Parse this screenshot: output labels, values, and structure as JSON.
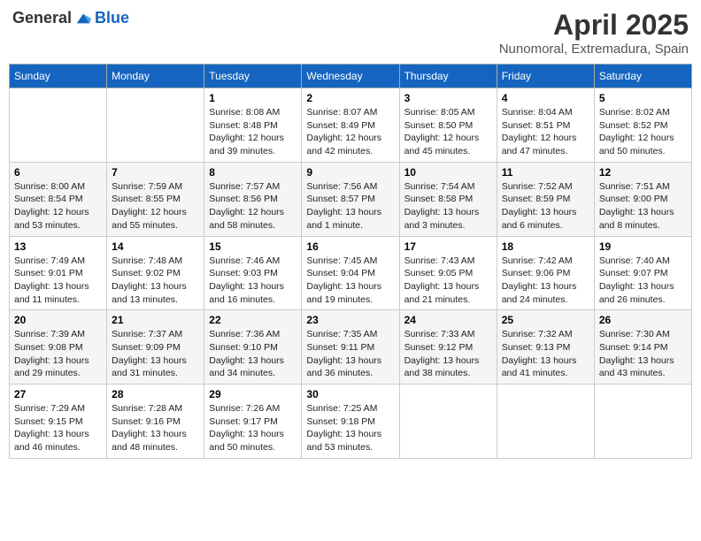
{
  "header": {
    "logo_general": "General",
    "logo_blue": "Blue",
    "month_title": "April 2025",
    "location": "Nunomoral, Extremadura, Spain"
  },
  "days_of_week": [
    "Sunday",
    "Monday",
    "Tuesday",
    "Wednesday",
    "Thursday",
    "Friday",
    "Saturday"
  ],
  "weeks": [
    [
      {
        "day": null,
        "sunrise": null,
        "sunset": null,
        "daylight": null
      },
      {
        "day": null,
        "sunrise": null,
        "sunset": null,
        "daylight": null
      },
      {
        "day": "1",
        "sunrise": "Sunrise: 8:08 AM",
        "sunset": "Sunset: 8:48 PM",
        "daylight": "Daylight: 12 hours and 39 minutes."
      },
      {
        "day": "2",
        "sunrise": "Sunrise: 8:07 AM",
        "sunset": "Sunset: 8:49 PM",
        "daylight": "Daylight: 12 hours and 42 minutes."
      },
      {
        "day": "3",
        "sunrise": "Sunrise: 8:05 AM",
        "sunset": "Sunset: 8:50 PM",
        "daylight": "Daylight: 12 hours and 45 minutes."
      },
      {
        "day": "4",
        "sunrise": "Sunrise: 8:04 AM",
        "sunset": "Sunset: 8:51 PM",
        "daylight": "Daylight: 12 hours and 47 minutes."
      },
      {
        "day": "5",
        "sunrise": "Sunrise: 8:02 AM",
        "sunset": "Sunset: 8:52 PM",
        "daylight": "Daylight: 12 hours and 50 minutes."
      }
    ],
    [
      {
        "day": "6",
        "sunrise": "Sunrise: 8:00 AM",
        "sunset": "Sunset: 8:54 PM",
        "daylight": "Daylight: 12 hours and 53 minutes."
      },
      {
        "day": "7",
        "sunrise": "Sunrise: 7:59 AM",
        "sunset": "Sunset: 8:55 PM",
        "daylight": "Daylight: 12 hours and 55 minutes."
      },
      {
        "day": "8",
        "sunrise": "Sunrise: 7:57 AM",
        "sunset": "Sunset: 8:56 PM",
        "daylight": "Daylight: 12 hours and 58 minutes."
      },
      {
        "day": "9",
        "sunrise": "Sunrise: 7:56 AM",
        "sunset": "Sunset: 8:57 PM",
        "daylight": "Daylight: 13 hours and 1 minute."
      },
      {
        "day": "10",
        "sunrise": "Sunrise: 7:54 AM",
        "sunset": "Sunset: 8:58 PM",
        "daylight": "Daylight: 13 hours and 3 minutes."
      },
      {
        "day": "11",
        "sunrise": "Sunrise: 7:52 AM",
        "sunset": "Sunset: 8:59 PM",
        "daylight": "Daylight: 13 hours and 6 minutes."
      },
      {
        "day": "12",
        "sunrise": "Sunrise: 7:51 AM",
        "sunset": "Sunset: 9:00 PM",
        "daylight": "Daylight: 13 hours and 8 minutes."
      }
    ],
    [
      {
        "day": "13",
        "sunrise": "Sunrise: 7:49 AM",
        "sunset": "Sunset: 9:01 PM",
        "daylight": "Daylight: 13 hours and 11 minutes."
      },
      {
        "day": "14",
        "sunrise": "Sunrise: 7:48 AM",
        "sunset": "Sunset: 9:02 PM",
        "daylight": "Daylight: 13 hours and 13 minutes."
      },
      {
        "day": "15",
        "sunrise": "Sunrise: 7:46 AM",
        "sunset": "Sunset: 9:03 PM",
        "daylight": "Daylight: 13 hours and 16 minutes."
      },
      {
        "day": "16",
        "sunrise": "Sunrise: 7:45 AM",
        "sunset": "Sunset: 9:04 PM",
        "daylight": "Daylight: 13 hours and 19 minutes."
      },
      {
        "day": "17",
        "sunrise": "Sunrise: 7:43 AM",
        "sunset": "Sunset: 9:05 PM",
        "daylight": "Daylight: 13 hours and 21 minutes."
      },
      {
        "day": "18",
        "sunrise": "Sunrise: 7:42 AM",
        "sunset": "Sunset: 9:06 PM",
        "daylight": "Daylight: 13 hours and 24 minutes."
      },
      {
        "day": "19",
        "sunrise": "Sunrise: 7:40 AM",
        "sunset": "Sunset: 9:07 PM",
        "daylight": "Daylight: 13 hours and 26 minutes."
      }
    ],
    [
      {
        "day": "20",
        "sunrise": "Sunrise: 7:39 AM",
        "sunset": "Sunset: 9:08 PM",
        "daylight": "Daylight: 13 hours and 29 minutes."
      },
      {
        "day": "21",
        "sunrise": "Sunrise: 7:37 AM",
        "sunset": "Sunset: 9:09 PM",
        "daylight": "Daylight: 13 hours and 31 minutes."
      },
      {
        "day": "22",
        "sunrise": "Sunrise: 7:36 AM",
        "sunset": "Sunset: 9:10 PM",
        "daylight": "Daylight: 13 hours and 34 minutes."
      },
      {
        "day": "23",
        "sunrise": "Sunrise: 7:35 AM",
        "sunset": "Sunset: 9:11 PM",
        "daylight": "Daylight: 13 hours and 36 minutes."
      },
      {
        "day": "24",
        "sunrise": "Sunrise: 7:33 AM",
        "sunset": "Sunset: 9:12 PM",
        "daylight": "Daylight: 13 hours and 38 minutes."
      },
      {
        "day": "25",
        "sunrise": "Sunrise: 7:32 AM",
        "sunset": "Sunset: 9:13 PM",
        "daylight": "Daylight: 13 hours and 41 minutes."
      },
      {
        "day": "26",
        "sunrise": "Sunrise: 7:30 AM",
        "sunset": "Sunset: 9:14 PM",
        "daylight": "Daylight: 13 hours and 43 minutes."
      }
    ],
    [
      {
        "day": "27",
        "sunrise": "Sunrise: 7:29 AM",
        "sunset": "Sunset: 9:15 PM",
        "daylight": "Daylight: 13 hours and 46 minutes."
      },
      {
        "day": "28",
        "sunrise": "Sunrise: 7:28 AM",
        "sunset": "Sunset: 9:16 PM",
        "daylight": "Daylight: 13 hours and 48 minutes."
      },
      {
        "day": "29",
        "sunrise": "Sunrise: 7:26 AM",
        "sunset": "Sunset: 9:17 PM",
        "daylight": "Daylight: 13 hours and 50 minutes."
      },
      {
        "day": "30",
        "sunrise": "Sunrise: 7:25 AM",
        "sunset": "Sunset: 9:18 PM",
        "daylight": "Daylight: 13 hours and 53 minutes."
      },
      {
        "day": null,
        "sunrise": null,
        "sunset": null,
        "daylight": null
      },
      {
        "day": null,
        "sunrise": null,
        "sunset": null,
        "daylight": null
      },
      {
        "day": null,
        "sunrise": null,
        "sunset": null,
        "daylight": null
      }
    ]
  ]
}
